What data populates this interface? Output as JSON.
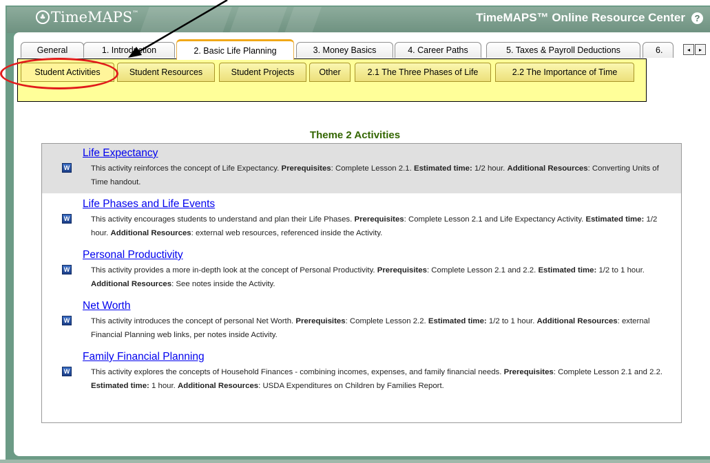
{
  "header": {
    "logo_text": "TimeMAPS",
    "logo_tm": "™",
    "logo_symbol": "♣",
    "site_title": "TimeMAPS™ Online Resource Center",
    "help_icon": "help-circle-icon",
    "help_symbol": "?"
  },
  "main_tabs": [
    {
      "label": "General"
    },
    {
      "label": "1. Introduction"
    },
    {
      "label": "2. Basic Life Planning",
      "active": true
    },
    {
      "label": "3. Money Basics"
    },
    {
      "label": "4. Career Paths"
    },
    {
      "label": "5. Taxes & Payroll Deductions"
    },
    {
      "label": "6."
    }
  ],
  "tab_scroll": {
    "prev": "◂",
    "next": "▸"
  },
  "sub_tabs": [
    {
      "label": "Student Activities",
      "active": true
    },
    {
      "label": "Student Resources"
    },
    {
      "label": "Student Projects"
    },
    {
      "label": "Other"
    },
    {
      "label": "2.1 The Three Phases of Life"
    },
    {
      "label": "2.2 The Importance of Time"
    }
  ],
  "content": {
    "section_title": "Theme 2 Activities",
    "doc_icon_letter": "W",
    "activities": [
      {
        "title": "Life Expectancy",
        "text": "This activity reinforces the concept of Life Expectancy.",
        "prereq_label": "Prerequisites",
        "prereq": ": Complete Lesson 2.1.",
        "time_label": "Estimated time:",
        "time": "1/2 hour.",
        "res_label": "Additional Resources",
        "res": ": Converting Units of Time handout."
      },
      {
        "title": "Life Phases and Life Events",
        "text": "This activity encourages students to understand and plan their Life Phases.",
        "prereq_label": "Prerequisites",
        "prereq": ": Complete Lesson 2.1 and Life Expectancy Activity.",
        "time_label": "Estimated time:",
        "time": "1/2 hour.",
        "res_label": "Additional Resources",
        "res": ": external web resources, referenced inside the Activity."
      },
      {
        "title": "Personal Productivity",
        "text": "This activity provides a more in-depth look at the concept of Personal Productivity.",
        "prereq_label": "Prerequisites",
        "prereq": ": Complete Lesson 2.1 and 2.2.",
        "time_label": "Estimated time:",
        "time": "1/2 to 1 hour.",
        "res_label": "Additional Resources",
        "res": ": See notes inside the Activity."
      },
      {
        "title": "Net Worth",
        "text": "This activity introduces the concept of personal Net Worth.",
        "prereq_label": "Prerequisites",
        "prereq": ": Complete Lesson 2.2.",
        "time_label": "Estimated time:",
        "time": "1/2 to 1 hour.",
        "res_label": "Additional Resources",
        "res": ": external Financial Planning web links, per notes inside Activity."
      },
      {
        "title": "Family Financial Planning",
        "text": "This activity explores the concepts of Household Finances - combining incomes, expenses, and family financial needs.",
        "prereq_label": "Prerequisites",
        "prereq": ": Complete Lesson 2.1 and 2.2.",
        "time_label": "Estimated time:",
        "time": "1 hour.",
        "res_label": "Additional Resources",
        "res": ": USDA Expenditures on Children by Families Report."
      }
    ]
  },
  "annotations": {
    "circle_color": "#e11b1b",
    "arrow_color": "#000000"
  }
}
